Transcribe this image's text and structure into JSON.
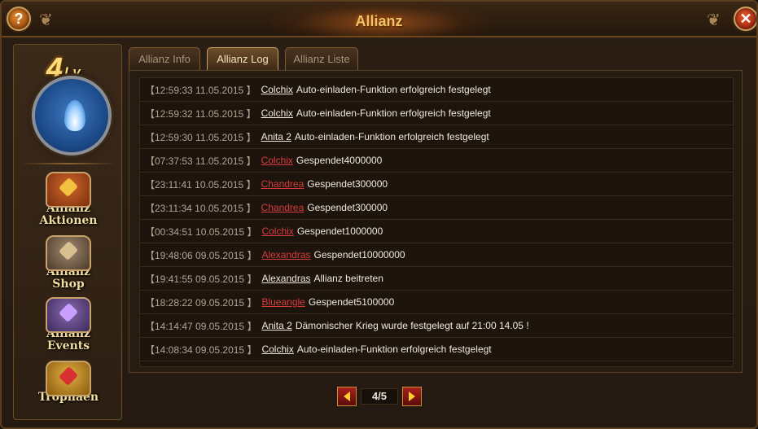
{
  "window": {
    "title": "Allianz"
  },
  "buttons": {
    "help_label": "?",
    "close_label": "✕"
  },
  "sidebar": {
    "level_number": "4",
    "level_suffix": "Lv.",
    "items": [
      {
        "label_line1": "Allianz",
        "label_line2": "Aktionen",
        "icon": "alliance-actions-icon"
      },
      {
        "label_line1": "Allianz",
        "label_line2": "Shop",
        "icon": "alliance-shop-icon"
      },
      {
        "label_line1": "Allianz",
        "label_line2": "Events",
        "icon": "alliance-events-icon"
      },
      {
        "label_line1": "Trophäen",
        "label_line2": "",
        "icon": "trophy-icon"
      }
    ]
  },
  "tabs": [
    {
      "label": "Allianz Info",
      "active": false
    },
    {
      "label": "Allianz Log",
      "active": true
    },
    {
      "label": "Allianz Liste",
      "active": false
    }
  ],
  "log": [
    {
      "time": "【12:59:33 11.05.2015 】",
      "name": "Colchix",
      "name_color": "white",
      "message": "Auto-einladen-Funktion erfolgreich festgelegt"
    },
    {
      "time": "【12:59:32 11.05.2015 】",
      "name": "Colchix",
      "name_color": "white",
      "message": "Auto-einladen-Funktion erfolgreich festgelegt"
    },
    {
      "time": "【12:59:30 11.05.2015 】",
      "name": "Anita 2",
      "name_color": "white",
      "message": "Auto-einladen-Funktion erfolgreich festgelegt"
    },
    {
      "time": "【07:37:53 11.05.2015 】",
      "name": "Colchix",
      "name_color": "red",
      "message": "Gespendet4000000"
    },
    {
      "time": "【23:11:41 10.05.2015 】",
      "name": "Chandrea",
      "name_color": "red",
      "message": "Gespendet300000"
    },
    {
      "time": "【23:11:34 10.05.2015 】",
      "name": "Chandrea",
      "name_color": "red",
      "message": "Gespendet300000"
    },
    {
      "time": "【00:34:51 10.05.2015 】",
      "name": "Colchix",
      "name_color": "red",
      "message": "Gespendet1000000"
    },
    {
      "time": "【19:48:06 09.05.2015 】",
      "name": "Alexandras",
      "name_color": "red",
      "message": "Gespendet10000000"
    },
    {
      "time": "【19:41:55 09.05.2015 】",
      "name": "Alexandras",
      "name_color": "white",
      "message": "Allianz beitreten"
    },
    {
      "time": "【18:28:22 09.05.2015 】",
      "name": "Blueangle",
      "name_color": "red",
      "message": "Gespendet5100000"
    },
    {
      "time": "【14:14:47 09.05.2015 】",
      "name": "Anita 2",
      "name_color": "white",
      "message": "Dämonischer Krieg wurde festgelegt auf 21:00 14.05 !"
    },
    {
      "time": "【14:08:34 09.05.2015 】",
      "name": "Colchix",
      "name_color": "white",
      "message": "Auto-einladen-Funktion erfolgreich festgelegt"
    }
  ],
  "pager": {
    "text": "4/5"
  },
  "colors": {
    "name_red": "#d83c3c",
    "name_white": "#f0e8dc",
    "title_gold": "#f1c468"
  }
}
